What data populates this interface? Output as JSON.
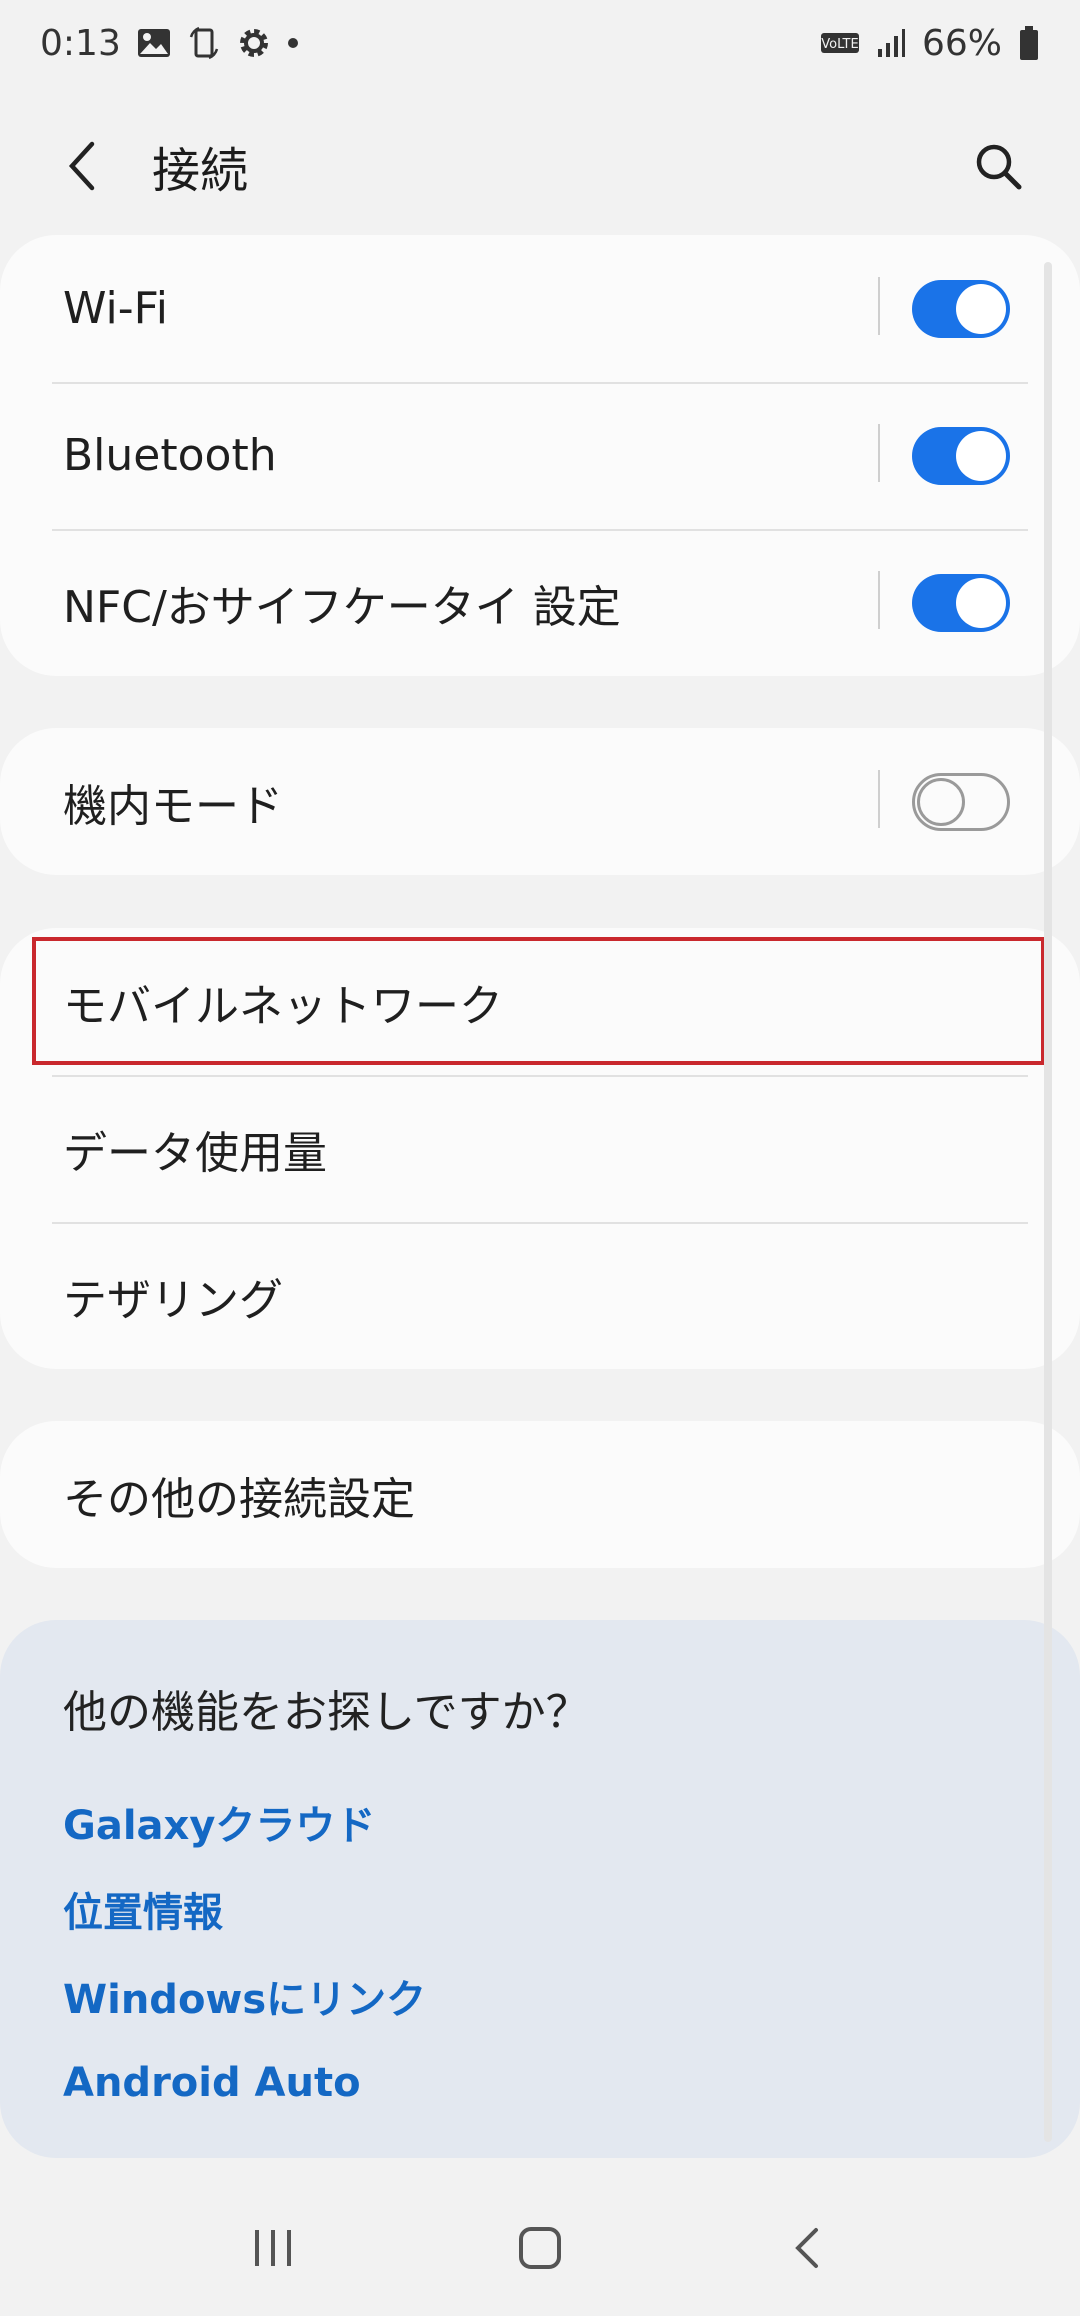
{
  "status": {
    "time": "0:13",
    "battery": "66%",
    "icons": [
      "gallery-icon",
      "screen-rotate-icon",
      "settings-icon",
      "dot-icon",
      "volte-icon",
      "signal-icon",
      "battery-icon"
    ]
  },
  "header": {
    "title": "接続"
  },
  "groups": {
    "radios": [
      {
        "label": "Wi-Fi",
        "toggle": "on"
      },
      {
        "label": "Bluetooth",
        "toggle": "on"
      },
      {
        "label": "NFC/おサイフケータイ 設定",
        "toggle": "on"
      }
    ],
    "airplane": {
      "label": "機内モード",
      "toggle": "off"
    },
    "network": [
      {
        "label": "モバイルネットワーク"
      },
      {
        "label": "データ使用量"
      },
      {
        "label": "テザリング"
      }
    ],
    "more": {
      "label": "その他の接続設定"
    }
  },
  "suggestions": {
    "title": "他の機能をお探しですか？",
    "links": [
      "Galaxyクラウド",
      "位置情報",
      "Windowsにリンク",
      "Android Auto"
    ]
  },
  "colors": {
    "accent": "#1a73e8",
    "link": "#1468c4",
    "highlight": "#c9282d",
    "card_bg": "#fbfbfb",
    "suggest_bg": "#e3e8f0"
  }
}
